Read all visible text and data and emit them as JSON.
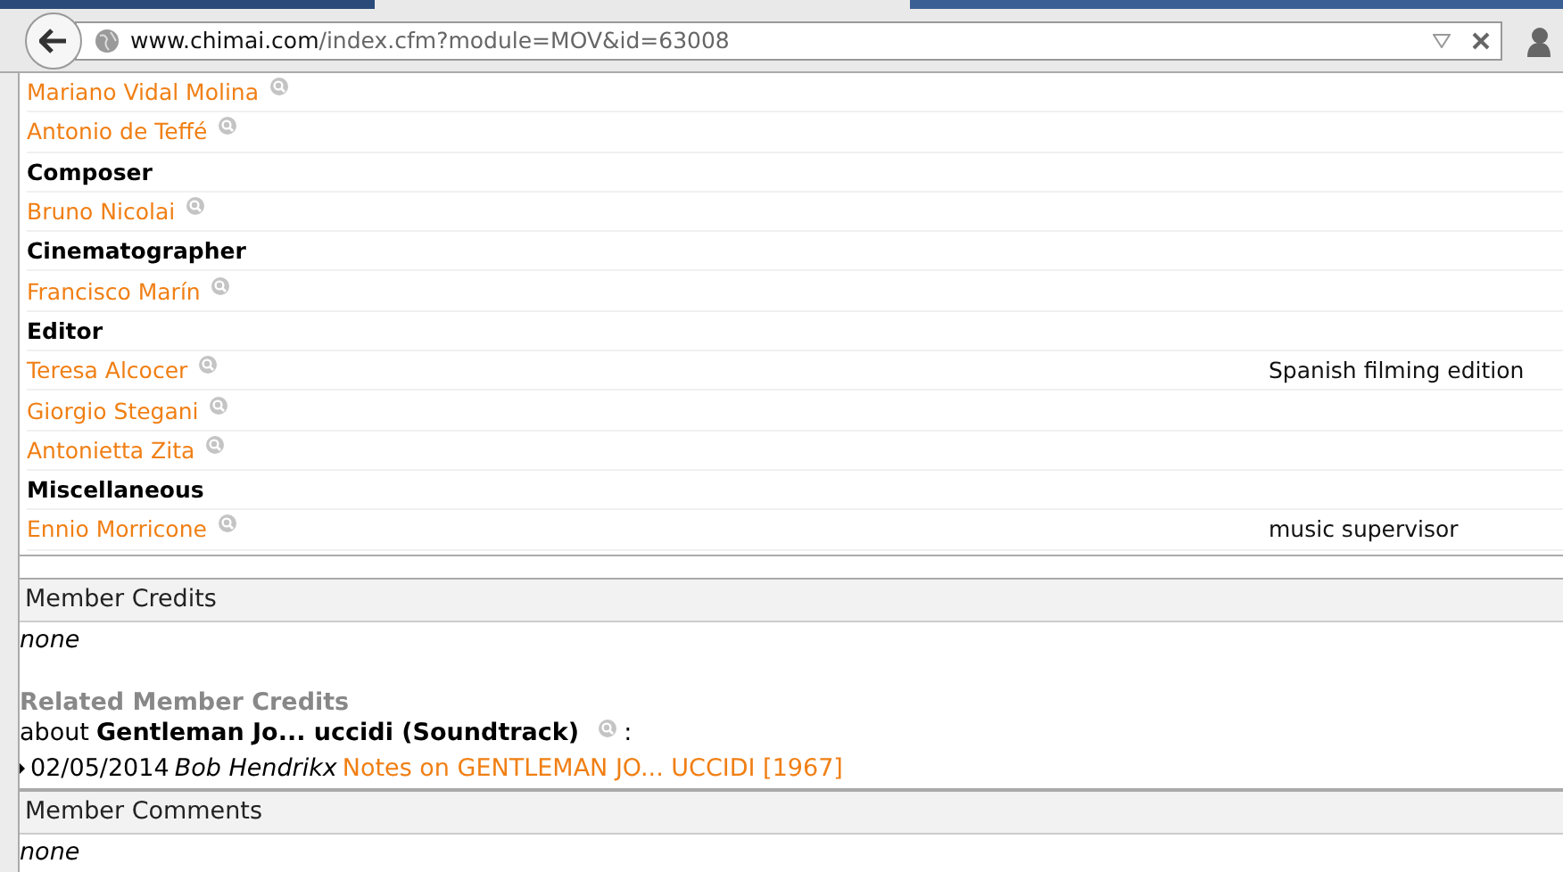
{
  "browser": {
    "url_host": "www.chimai.com",
    "url_path": "/index.cfm?module=MOV&id=63008"
  },
  "credits": [
    {
      "kind": "person",
      "name": "Mariano Vidal Molina"
    },
    {
      "kind": "person",
      "name": "Antonio de Teffé"
    },
    {
      "kind": "role",
      "name": "Composer"
    },
    {
      "kind": "person",
      "name": "Bruno Nicolai"
    },
    {
      "kind": "role",
      "name": "Cinematographer"
    },
    {
      "kind": "person",
      "name": "Francisco Marín"
    },
    {
      "kind": "role",
      "name": "Editor"
    },
    {
      "kind": "person",
      "name": "Teresa Alcocer",
      "note": "Spanish filming edition"
    },
    {
      "kind": "person",
      "name": "Giorgio Stegani"
    },
    {
      "kind": "person",
      "name": "Antonietta Zita"
    },
    {
      "kind": "role",
      "name": "Miscellaneous"
    },
    {
      "kind": "person",
      "name": "Ennio Morricone",
      "note": "music supervisor"
    }
  ],
  "member_credits": {
    "title": "Member Credits",
    "text": "none"
  },
  "related": {
    "title": "Related Member Credits",
    "about": "about",
    "subject": "Gentleman Jo... uccidi (Soundtrack)",
    "colon": ":",
    "entries": [
      {
        "date": "02/05/2014",
        "author": "Bob Hendrikx",
        "link": "Notes on GENTLEMAN JO... UCCIDI [1967]"
      }
    ]
  },
  "member_comments": {
    "title": "Member Comments",
    "text": "none"
  }
}
